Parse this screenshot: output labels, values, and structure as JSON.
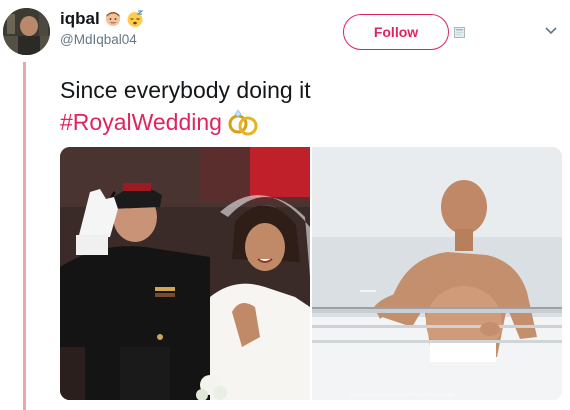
{
  "user": {
    "display_name": "iqbal",
    "handle": "@MdIqbal04",
    "avatar_icon": "profile-photo",
    "name_emojis": [
      "man-emoji",
      "sleepy-face-emoji"
    ]
  },
  "actions": {
    "follow_label": "Follow",
    "menu_icon": "chevron-down-icon"
  },
  "tweet": {
    "line1": "Since everybody doing it",
    "hashtag": "#RoyalWedding",
    "hashtag_icon": "rings-icon"
  },
  "media": {
    "left_photo": "royal-couple-photo",
    "right_photo": "shirtless-man-balcony-photo",
    "credit": "© Ross Kinnaird/Getty Images; ©FAST/CelebsHome"
  },
  "colors": {
    "accent": "#e0245e",
    "thread_line": "#e8a5b2",
    "secondary_text": "#657786"
  }
}
